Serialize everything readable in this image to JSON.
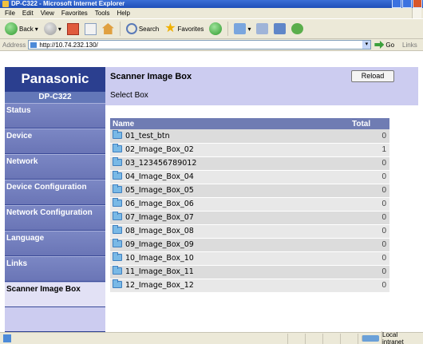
{
  "window": {
    "title": "DP-C322 - Microsoft Internet Explorer"
  },
  "menu": [
    "File",
    "Edit",
    "View",
    "Favorites",
    "Tools",
    "Help"
  ],
  "toolbar": {
    "back_label": "Back",
    "search_label": "Search",
    "favorites_label": "Favorites"
  },
  "address": {
    "label": "Address",
    "url": "http://10.74.232.130/",
    "go_label": "Go",
    "links_label": "Links"
  },
  "brand": {
    "logo": "Panasonic",
    "model": "DP-C322"
  },
  "nav": [
    {
      "label": "Status"
    },
    {
      "label": "Device"
    },
    {
      "label": "Network"
    },
    {
      "label": "Device Configuration"
    },
    {
      "label": "Network Configuration"
    },
    {
      "label": "Language"
    },
    {
      "label": "Links"
    },
    {
      "label": "Scanner Image Box"
    }
  ],
  "main": {
    "title": "Scanner Image Box",
    "subtitle": "Select Box",
    "reload_label": "Reload"
  },
  "table": {
    "headers": {
      "name": "Name",
      "total": "Total"
    },
    "rows": [
      {
        "name": "01_test_btn",
        "total": "0"
      },
      {
        "name": "02_Image_Box_02",
        "total": "1"
      },
      {
        "name": "03_123456789012",
        "total": "0"
      },
      {
        "name": "04_Image_Box_04",
        "total": "0"
      },
      {
        "name": "05_Image_Box_05",
        "total": "0"
      },
      {
        "name": "06_Image_Box_06",
        "total": "0"
      },
      {
        "name": "07_Image_Box_07",
        "total": "0"
      },
      {
        "name": "08_Image_Box_08",
        "total": "0"
      },
      {
        "name": "09_Image_Box_09",
        "total": "0"
      },
      {
        "name": "10_Image_Box_10",
        "total": "0"
      },
      {
        "name": "11_Image_Box_11",
        "total": "0"
      },
      {
        "name": "12_Image_Box_12",
        "total": "0"
      }
    ]
  },
  "status": {
    "zone": "Local intranet"
  }
}
